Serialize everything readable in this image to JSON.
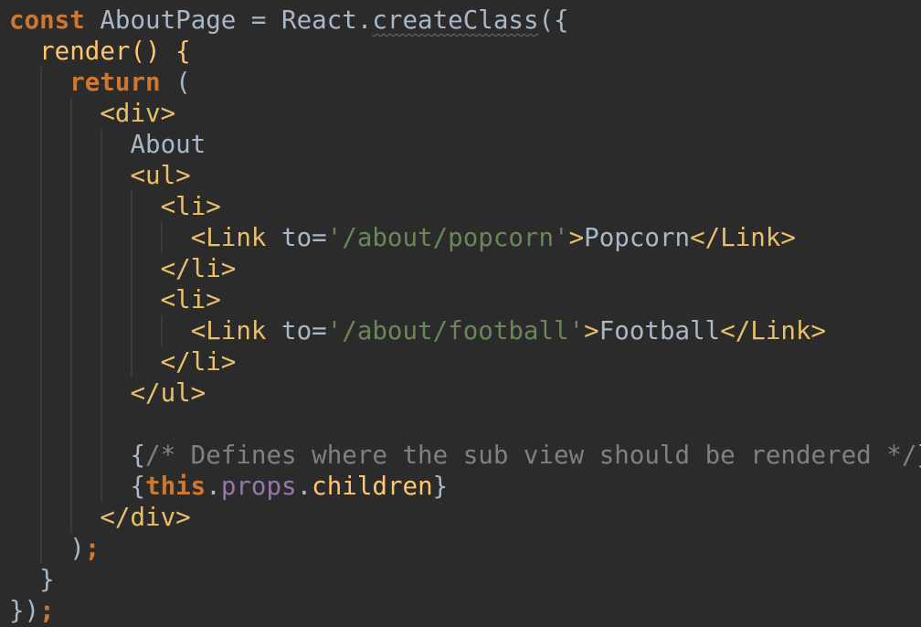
{
  "code_lines": [
    {
      "tokens": [
        {
          "t": "const",
          "c": "kw"
        },
        {
          "t": " AboutPage = React.",
          "c": "pl"
        },
        {
          "t": "createClass",
          "c": "pl sq"
        },
        {
          "t": "({",
          "c": "pl"
        }
      ]
    },
    {
      "tokens": [
        {
          "t": "  render() {",
          "c": "fn"
        }
      ]
    },
    {
      "tokens": [
        {
          "t": "    ",
          "c": "pl"
        },
        {
          "t": "return",
          "c": "kw"
        },
        {
          "t": " (",
          "c": "pl"
        }
      ]
    },
    {
      "tokens": [
        {
          "t": "      ",
          "c": "pl"
        },
        {
          "t": "<div>",
          "c": "tag"
        }
      ]
    },
    {
      "tokens": [
        {
          "t": "        About",
          "c": "pl"
        }
      ]
    },
    {
      "tokens": [
        {
          "t": "        ",
          "c": "pl"
        },
        {
          "t": "<ul>",
          "c": "tag"
        }
      ]
    },
    {
      "tokens": [
        {
          "t": "          ",
          "c": "pl"
        },
        {
          "t": "<li>",
          "c": "tag"
        }
      ]
    },
    {
      "tokens": [
        {
          "t": "            ",
          "c": "pl"
        },
        {
          "t": "<Link ",
          "c": "tag"
        },
        {
          "t": "to=",
          "c": "pl"
        },
        {
          "t": "'/about/popcorn'",
          "c": "str"
        },
        {
          "t": ">",
          "c": "tag"
        },
        {
          "t": "Popcorn",
          "c": "pl"
        },
        {
          "t": "</Link>",
          "c": "tag"
        }
      ]
    },
    {
      "tokens": [
        {
          "t": "          ",
          "c": "pl"
        },
        {
          "t": "</li>",
          "c": "tag"
        }
      ]
    },
    {
      "tokens": [
        {
          "t": "          ",
          "c": "pl"
        },
        {
          "t": "<li>",
          "c": "tag"
        }
      ]
    },
    {
      "tokens": [
        {
          "t": "            ",
          "c": "pl"
        },
        {
          "t": "<Link ",
          "c": "tag"
        },
        {
          "t": "to=",
          "c": "pl"
        },
        {
          "t": "'/about/football'",
          "c": "str"
        },
        {
          "t": ">",
          "c": "tag"
        },
        {
          "t": "Football",
          "c": "pl"
        },
        {
          "t": "</Link>",
          "c": "tag"
        }
      ]
    },
    {
      "tokens": [
        {
          "t": "          ",
          "c": "pl"
        },
        {
          "t": "</li>",
          "c": "tag"
        }
      ]
    },
    {
      "tokens": [
        {
          "t": "        ",
          "c": "pl"
        },
        {
          "t": "</ul>",
          "c": "tag"
        }
      ]
    },
    {
      "tokens": [
        {
          "t": "",
          "c": "pl"
        }
      ]
    },
    {
      "tokens": [
        {
          "t": "        {",
          "c": "pl"
        },
        {
          "t": "/* Defines where the sub view should be rendered */",
          "c": "cm"
        },
        {
          "t": "}",
          "c": "pl"
        }
      ]
    },
    {
      "tokens": [
        {
          "t": "        {",
          "c": "pl"
        },
        {
          "t": "this",
          "c": "kw"
        },
        {
          "t": ".",
          "c": "pl"
        },
        {
          "t": "props",
          "c": "pr"
        },
        {
          "t": ".",
          "c": "pl"
        },
        {
          "t": "children",
          "c": "fn"
        },
        {
          "t": "}",
          "c": "pl"
        }
      ]
    },
    {
      "tokens": [
        {
          "t": "      ",
          "c": "pl"
        },
        {
          "t": "</div>",
          "c": "tag"
        }
      ]
    },
    {
      "tokens": [
        {
          "t": "    )",
          "c": "pl"
        },
        {
          "t": ";",
          "c": "kw"
        }
      ]
    },
    {
      "tokens": [
        {
          "t": "  }",
          "c": "pl"
        }
      ]
    },
    {
      "tokens": [
        {
          "t": "})",
          "c": "pl"
        },
        {
          "t": ";",
          "c": "kw"
        }
      ]
    }
  ],
  "colors": {
    "background": "#2b2b2b",
    "keyword": "#cc7832",
    "plain": "#a9b7c6",
    "function": "#ffc66d",
    "tag": "#e8bf6a",
    "string": "#6a8759",
    "comment": "#808080",
    "property": "#9876aa"
  }
}
